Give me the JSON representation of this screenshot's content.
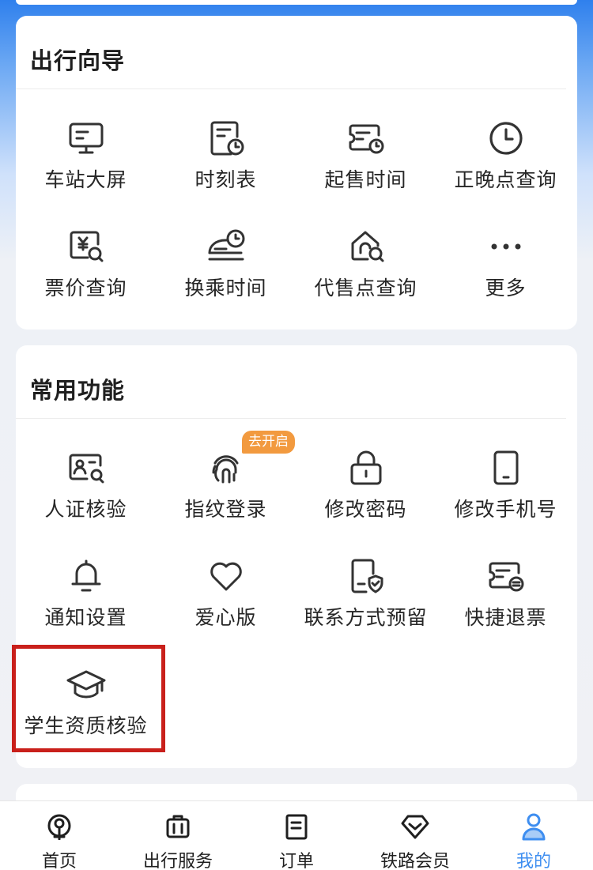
{
  "guide": {
    "title": "出行向导",
    "items": [
      {
        "label": "车站大屏",
        "icon": "station-screen-icon"
      },
      {
        "label": "时刻表",
        "icon": "timetable-icon"
      },
      {
        "label": "起售时间",
        "icon": "sale-time-icon"
      },
      {
        "label": "正晚点查询",
        "icon": "clock-icon"
      },
      {
        "label": "票价查询",
        "icon": "fare-search-icon"
      },
      {
        "label": "换乘时间",
        "icon": "transfer-time-icon"
      },
      {
        "label": "代售点查询",
        "icon": "agency-search-icon"
      },
      {
        "label": "更多",
        "icon": "more-dots-icon"
      }
    ]
  },
  "common": {
    "title": "常用功能",
    "badge": "去开启",
    "items": [
      {
        "label": "人证核验",
        "icon": "id-verify-icon"
      },
      {
        "label": "指纹登录",
        "icon": "fingerprint-icon"
      },
      {
        "label": "修改密码",
        "icon": "lock-icon"
      },
      {
        "label": "修改手机号",
        "icon": "phone-icon"
      },
      {
        "label": "通知设置",
        "icon": "bell-icon"
      },
      {
        "label": "爱心版",
        "icon": "heart-icon"
      },
      {
        "label": "联系方式预留",
        "icon": "contact-shield-icon"
      },
      {
        "label": "快捷退票",
        "icon": "refund-ticket-icon"
      },
      {
        "label": "学生资质核验",
        "icon": "graduation-cap-icon"
      }
    ]
  },
  "tabs": [
    {
      "label": "首页",
      "icon": "railway-logo-icon",
      "active": false
    },
    {
      "label": "出行服务",
      "icon": "luggage-icon",
      "active": false
    },
    {
      "label": "订单",
      "icon": "order-list-icon",
      "active": false
    },
    {
      "label": "铁路会员",
      "icon": "diamond-icon",
      "active": false
    },
    {
      "label": "我的",
      "icon": "user-icon",
      "active": true
    }
  ],
  "colors": {
    "accent_blue": "#3e8ef0",
    "badge_orange": "#f29a3f",
    "highlight_red": "#c9201b",
    "icon_stroke": "#333333"
  }
}
